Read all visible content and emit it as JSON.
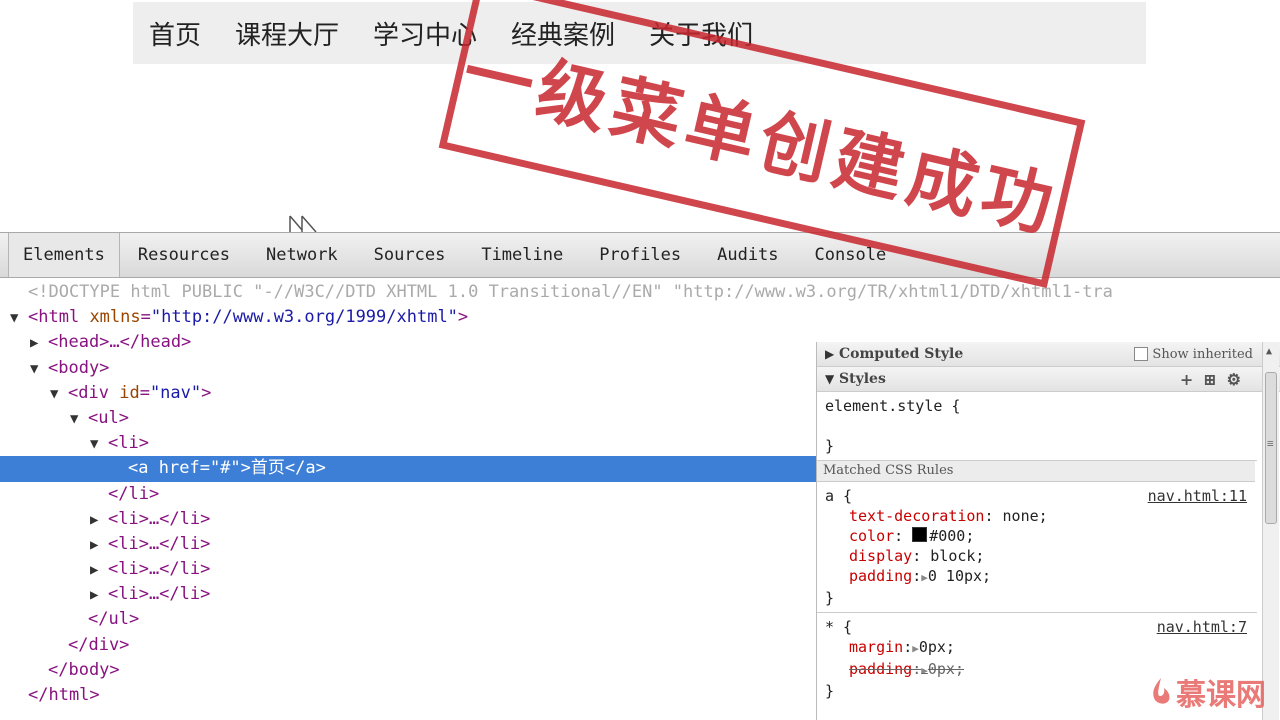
{
  "page_nav": [
    "首页",
    "课程大厅",
    "学习中心",
    "经典案例",
    "关于我们"
  ],
  "stamp": {
    "text": "一级菜单创建成功",
    "color": "#c8262e"
  },
  "devtools": {
    "tabs": [
      "Elements",
      "Resources",
      "Network",
      "Sources",
      "Timeline",
      "Profiles",
      "Audits",
      "Console"
    ],
    "active_tab": "Elements",
    "tree": {
      "doctype": "<!DOCTYPE html PUBLIC \"-//W3C//DTD XHTML 1.0 Transitional//EN\" \"http://www.w3.org/TR/xhtml1/DTD/xhtml1-tra",
      "html_open": "<html",
      "html_attr": "xmlns",
      "html_val": "\"http://www.w3.org/1999/xhtml\"",
      "gt": ">",
      "head": "<head>…</head>",
      "body_open": "<body>",
      "div_open": "<div",
      "div_attr": "id",
      "div_val": "\"nav\"",
      "ul_open": "<ul>",
      "li_open": "<li>",
      "a_open": "<a",
      "a_attr": "href",
      "a_val": "\"#\"",
      "a_text": "首页",
      "a_close": "</a>",
      "li_close": "</li>",
      "li_collapsed": "<li>…</li>",
      "ul_close": "</ul>",
      "div_close": "</div>",
      "body_close": "</body>",
      "html_close": "</html>"
    },
    "styles": {
      "computed_label": "Computed Style",
      "show_inherited": "Show inherited",
      "styles_label": "Styles",
      "element_style": "element.style {",
      "close_brace": "}",
      "matched_label": "Matched CSS Rules",
      "rule_a": {
        "selector": "a {",
        "source": "nav.html:11",
        "props": [
          {
            "name": "text-decoration",
            "value": "none;"
          },
          {
            "name": "color",
            "value": "#000;"
          },
          {
            "name": "display",
            "value": "block;"
          },
          {
            "name": "padding",
            "value": "0 10px;"
          }
        ]
      },
      "rule_star": {
        "selector": "* {",
        "source": "nav.html:7",
        "props": [
          {
            "name": "margin",
            "value": "0px;"
          },
          {
            "name": "padding",
            "value": "0px;"
          }
        ]
      }
    }
  },
  "logo": "慕课网",
  "colors": {
    "selection": "#3d7fd6",
    "tag": "#881280",
    "attr": "#994500",
    "value": "#1a1aa6"
  }
}
